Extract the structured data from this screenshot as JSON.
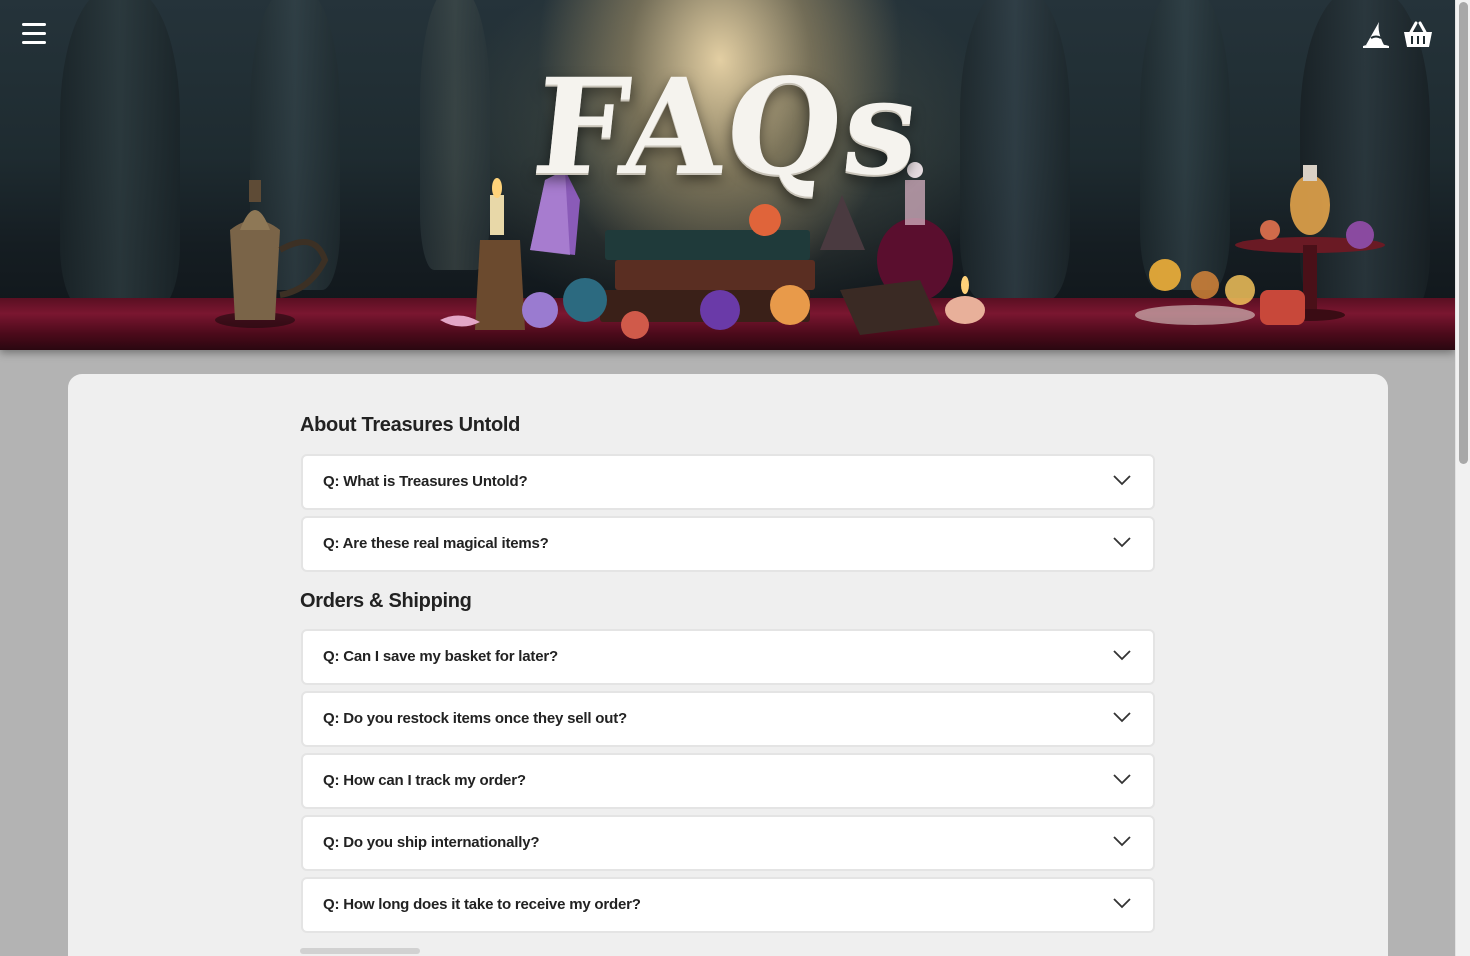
{
  "header": {
    "menu_icon": "hamburger-menu-icon",
    "wizard_hat_icon": "wizard-hat-icon",
    "basket_icon": "shopping-basket-icon"
  },
  "hero": {
    "title": "FAQs"
  },
  "sections": [
    {
      "title": "About Treasures Untold",
      "questions": [
        "Q: What is Treasures Untold?",
        "Q: Are these real magical items?"
      ]
    },
    {
      "title": "Orders & Shipping",
      "questions": [
        "Q: Can I save my basket for later?",
        "Q: Do you restock items once they sell out?",
        "Q: How can I track my order?",
        "Q: Do you ship internationally?",
        "Q: How long does it take to receive my order?"
      ]
    }
  ],
  "colors": {
    "card_background": "#efefef",
    "page_background": "#b3b3b3",
    "question_background": "#ffffff",
    "text": "#222222"
  }
}
